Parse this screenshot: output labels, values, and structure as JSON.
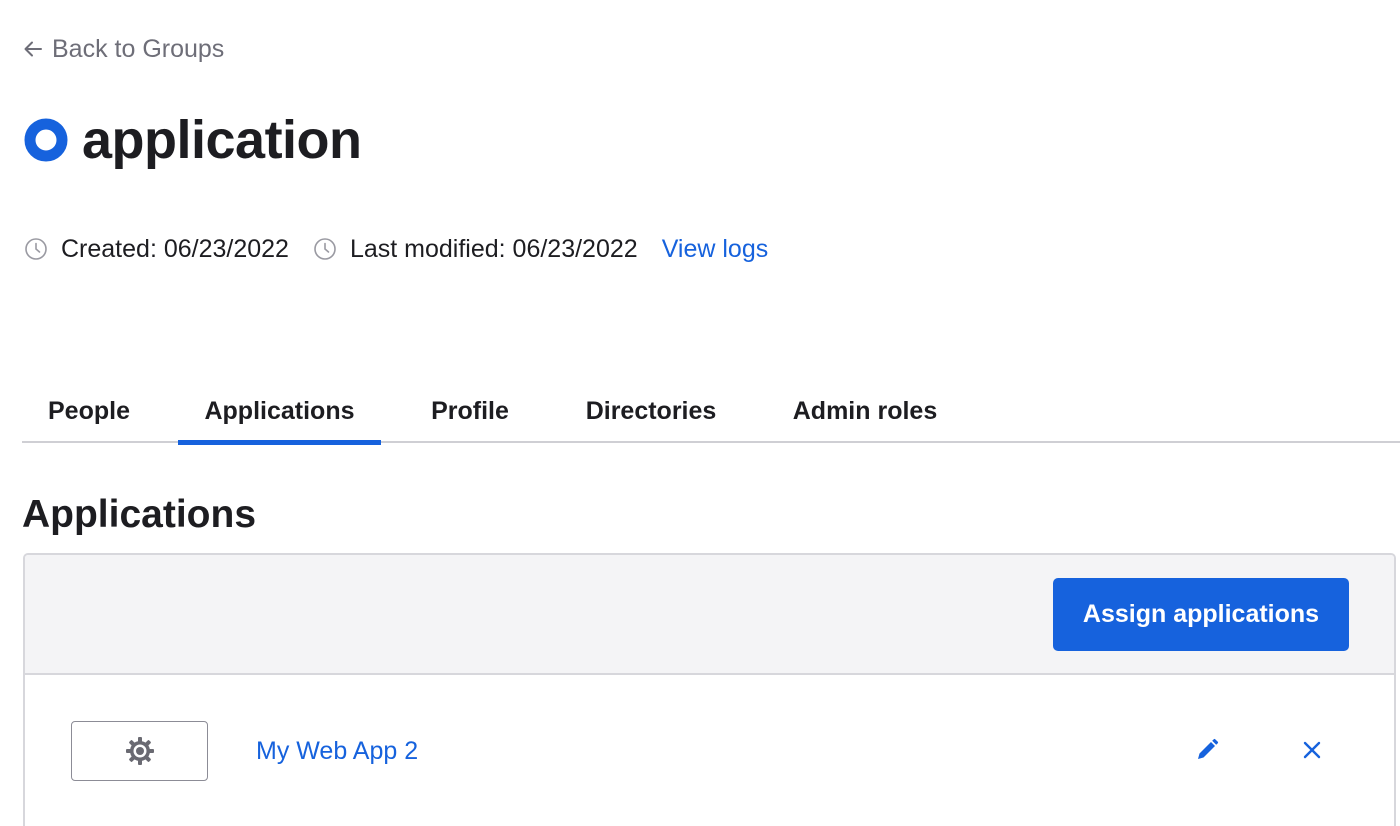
{
  "back_link": {
    "label": "Back to Groups"
  },
  "group": {
    "title": "application",
    "icon": "group-ring-icon",
    "accent_color": "#1662dd"
  },
  "meta": {
    "created_label": "Created: 06/23/2022",
    "modified_label": "Last modified: 06/23/2022",
    "view_logs_label": "View logs"
  },
  "tabs": [
    {
      "label": "People",
      "active": false
    },
    {
      "label": "Applications",
      "active": true
    },
    {
      "label": "Profile",
      "active": false
    },
    {
      "label": "Directories",
      "active": false
    },
    {
      "label": "Admin roles",
      "active": false
    }
  ],
  "section": {
    "heading": "Applications",
    "assign_button_label": "Assign applications"
  },
  "apps": [
    {
      "name": "My Web App 2",
      "logo_icon": "gear-icon"
    }
  ],
  "colors": {
    "primary": "#1662dd",
    "text": "#1d1d21",
    "muted": "#6e6e78",
    "toolbar_bg": "#f4f4f6"
  }
}
